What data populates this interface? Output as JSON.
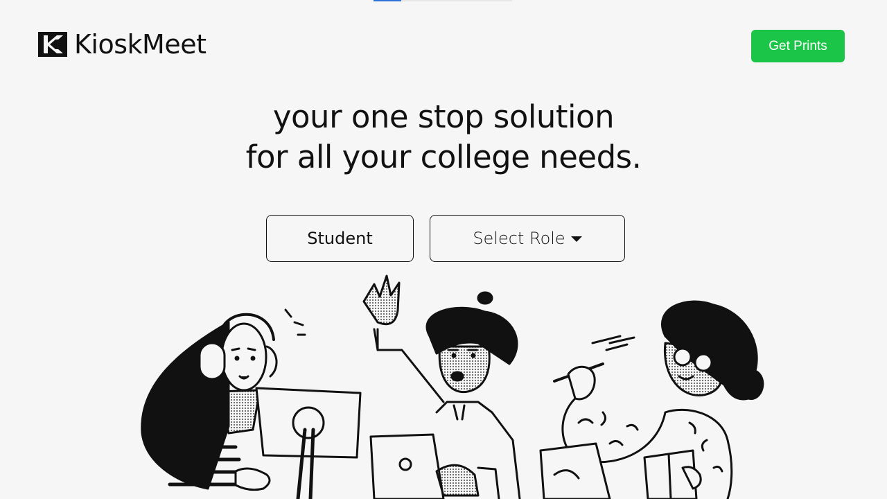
{
  "header": {
    "logo_text": "KioskMeet",
    "cta_label": "Get Prints",
    "cta_color": "#1bc547",
    "loading_progress": 0.2
  },
  "hero": {
    "headline_line1": "your one stop solution",
    "headline_line2": "for all your college needs."
  },
  "roles": {
    "selected_role": "Student",
    "select_label": "Select Role",
    "select_icon": "caret-down-icon"
  },
  "illustration": {
    "description_icon": "students-illustration"
  }
}
